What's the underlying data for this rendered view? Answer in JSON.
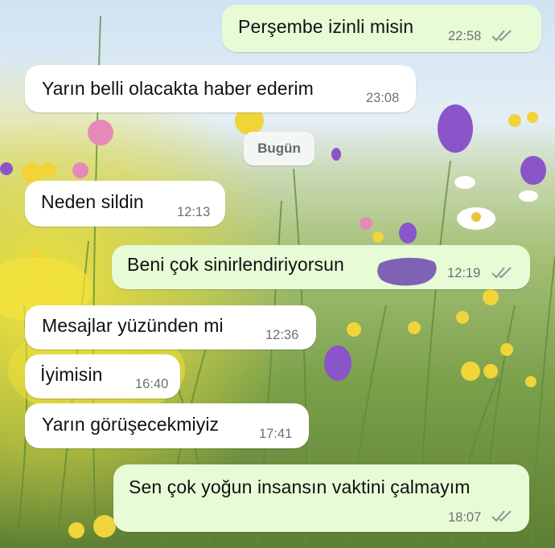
{
  "date_separator": "Bugün",
  "colors": {
    "incoming_bubble": "#ffffff",
    "outgoing_bubble": "#e7fbd6",
    "read_ticks": "#8a9a95",
    "redaction": "#7f62b5"
  },
  "messages": [
    {
      "direction": "outgoing",
      "text": "Perşembe izinli misin",
      "time": "22:58",
      "status": "double-check-icon"
    },
    {
      "direction": "incoming",
      "text": "Yarın belli olacakta haber ederim",
      "time": "23:08"
    },
    {
      "direction": "incoming",
      "text": "Neden sildin",
      "time": "12:13"
    },
    {
      "direction": "outgoing",
      "text": "Beni çok sinirlendiriyorsun",
      "time": "12:19",
      "status": "double-check-icon",
      "redacted": true
    },
    {
      "direction": "incoming",
      "text": "Mesajlar yüzünden mi",
      "time": "12:36"
    },
    {
      "direction": "incoming",
      "text": "İyimisin",
      "time": "16:40"
    },
    {
      "direction": "incoming",
      "text": "Yarın görüşecekmiyiz",
      "time": "17:41"
    },
    {
      "direction": "outgoing",
      "text": "Sen çok yoğun insansın vaktini çalmayım",
      "time": "18:07",
      "status": "double-check-icon"
    }
  ]
}
